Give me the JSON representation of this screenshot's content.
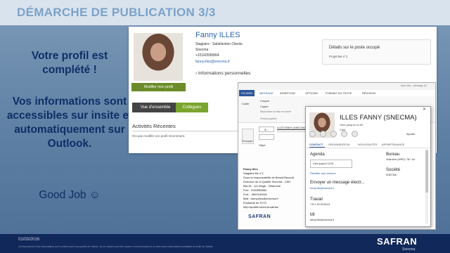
{
  "slide": {
    "title": "DÉMARCHE DE PUBLICATION 3/3",
    "left_line1": "Votre profil est complété !",
    "left_line2": "Vos informations sont accessibles sur insite et automatiquement sur Outlook.",
    "left_line3": "Good Job ☺",
    "date": "01/03/2016",
    "footnote": "Cet document et les informations qu'il contient sont la propriété de Safran. Ils ne doivent pas être copiés ni communiqués à un tiers sans l'autorisation préalable et écrite de Safran.",
    "logo": "SAFRAN",
    "logo_sub": "Snecma",
    "colors": {
      "title": "#7ba2c8",
      "left_text": "#0d2f66",
      "footer": "#11285a",
      "accent_green": "#7aa52f"
    }
  },
  "profile": {
    "name": "Fanny ILLES",
    "role": "Stagiaire - Satisfaction Clients",
    "company": "Snecma",
    "phone": "+33160595864",
    "email": "fanny.illes@snecma.fr",
    "edit_button": "Modifier mon profil",
    "personal_info": "› Informations personnelles",
    "details_title": "Détails sur le poste occupé",
    "details_project": "Projet Be n°1",
    "tab_overview": "Vue d'ensemble",
    "tab_colleagues": "Collègues",
    "activities_heading": "Activités Récentes",
    "activities_empty": "N'a pas modifié son profil récemment."
  },
  "outlook": {
    "window_title": "Sans titre - Message (H",
    "tabs": [
      "FICHIER",
      "MESSAGE",
      "INSERTION",
      "OPTIONS",
      "FORMAT DU TEXTE",
      "RÉVISION"
    ],
    "paste": "Coller",
    "cut": "Couper",
    "copy": "Copier",
    "format_painter": "Reproduire la mise en forme",
    "clipboard": "Presse-papiers",
    "send": "Envoyer",
    "to_button": "À...",
    "to_field": "ILLES FANNY (SNECMA)",
    "subject_label": "Objet",
    "signature_lines": [
      "Fanny Illes",
      "Stagiaire Be n°1",
      "Sous la responsabilité de Benoit Benault",
      "Direction de la Qualité Snecma - CAH",
      "Bât 36 - 1er étage - Villaroche",
      "Fixe : 0160595864",
      "Port. : 0652150461",
      "Mail : fanny.illes@snecma.fr",
      "Etudiante de l'UTC",
      "http://qualite.snecma.safran/"
    ],
    "signature_logo": "SAFRAN"
  },
  "contact_card": {
    "name": "ILLES FANNY (SNECMA)",
    "availability": "Libre jusqu'à 11:00",
    "company": "CAH",
    "add": "Ajouter",
    "tabs": [
      "CONTACT",
      "ORGANISATION",
      "NOUVEAUTÉS",
      "APPARTENANCE"
    ],
    "agenda_heading": "Agenda",
    "agenda_value": "Libre jusqu'à 11:00",
    "agenda_link": "Planifier une réunion",
    "bureau_heading": "Bureau",
    "bureau_value": "Villaroche (WRS) / 36 / 1er",
    "societe_heading": "Société",
    "societe_value": "SNECMA",
    "message_heading": "Envoyer un message électr...",
    "message_value": "fanny.illes@snecma.fr",
    "travail_heading": "Travail",
    "travail_value": "+33 1 60 59 58 64",
    "mi_heading": "MI",
    "mi_value": "fanny.illes@snecma.fr"
  }
}
